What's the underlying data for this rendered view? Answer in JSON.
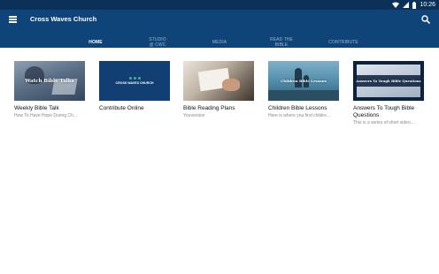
{
  "status_bar": {
    "time": "10:26",
    "icons": [
      "wifi-icon",
      "signal-icon",
      "battery-icon"
    ]
  },
  "app_bar": {
    "title": "Cross Waves Church",
    "menu_icon": "hamburger-menu-icon",
    "search_icon": "search-icon"
  },
  "tabs": [
    {
      "label": "HOME",
      "active": true
    },
    {
      "label": "STUDIO @ CWC",
      "active": false
    },
    {
      "label": "MEDIA",
      "active": false
    },
    {
      "label": "READ THE BIBLE",
      "active": false
    },
    {
      "label": "CONTRIBUTE",
      "active": false
    }
  ],
  "cards": [
    {
      "thumb_text": "Watch Bible Talks",
      "title": "Weekly Bible Talk",
      "subtitle": "How To Have Hope During Ch..."
    },
    {
      "thumb_text": "CROSS WAVES CHURCH",
      "title": "Contribute Online",
      "subtitle": ""
    },
    {
      "thumb_text": "",
      "title": "Bible Reading Plans",
      "subtitle": "Youversion"
    },
    {
      "thumb_text": "Children Bible Lessons",
      "title": "Children Bible Lessons",
      "subtitle": "Here is where you find childre..."
    },
    {
      "thumb_text": "Answers To Tough Bible Questions",
      "title": "Answers To Tough Bible Questions",
      "subtitle": "This is a series of short video..."
    }
  ],
  "colors": {
    "status_bar": "#0b3159",
    "app_bar": "#0f4478",
    "tab_inactive": "#9fb6cf",
    "tab_active": "#ffffff"
  }
}
